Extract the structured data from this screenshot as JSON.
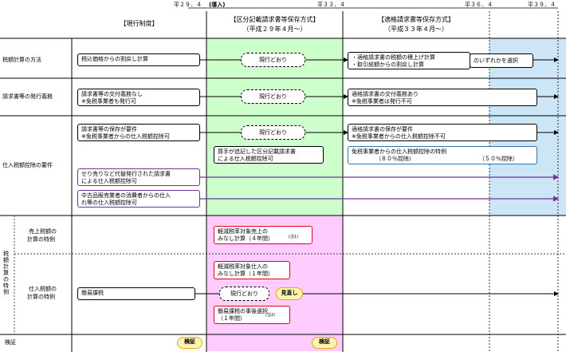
{
  "timeline": {
    "h29": "平２９．４",
    "h29_note": "(導入)",
    "h33": "平３３．４",
    "h36": "平３６．４",
    "h39": "平３９．４"
  },
  "columns": {
    "current": "【現行制度】",
    "kubun": "【区分記載請求書等保存方式】",
    "kubun_sub": "（平成２９年４月～）",
    "tekikaku": "【適格請求書等保存方式】",
    "tekikaku_sub": "（平成３３年４月～）"
  },
  "rows": {
    "calc": "税額計算の方法",
    "invoice": "請求書等の発行義務",
    "deduction": "仕入税額控除の要件",
    "sales_special_1": "売上税額の",
    "sales_special_2": "計算の特例",
    "purchase_special_1": "仕入税額の",
    "purchase_special_2": "計算の特例",
    "vertical_group": "税額計算の特例",
    "review": "検証"
  },
  "boxes": {
    "calc_current": "税込価格からの割戻し計算",
    "same": "現行どおり",
    "calc_new_1": "・適格請求書の税額の積上げ計算",
    "calc_new_2": "・取引総額からの割戻し計算",
    "calc_new_suffix": "のいずれかを選択",
    "invoice_current_1": "請求書等の交付義務なし",
    "invoice_current_2": "※免税事業者も発行可",
    "invoice_new_1": "適格請求書の交付義務あり",
    "invoice_new_2": "※免税事業者は発行不可",
    "deduction_current_1": "請求書等の保存が要件",
    "deduction_current_2": "※免税事業者からの仕入税額控除可",
    "deduction_new_1": "適格請求書の保存が要件",
    "deduction_new_2": "※免税事業者からの仕入税額控除不可",
    "buyer_note_1": "買手が追記した区分記載請求書",
    "buyer_note_2": "による仕入税額控除可",
    "exempt_special_1": "免税事業者からの仕入税額控除の特例",
    "exempt_special_2": "（８０％控除）",
    "exempt_special_3": "（５０％控除）",
    "agent_1": "せり売りなど代替発行された請求書",
    "agent_2": "による仕入税額控除可",
    "used_1": "中古品販売業者の消費者からの仕入",
    "used_2": "れ等の仕入税額控除可",
    "reduced_sales_1": "軽減税率対象売上の",
    "reduced_sales_2": "みなし計算（４年間）",
    "note1": "(注1)",
    "reduced_purchase_1": "軽減税率対象仕入の",
    "reduced_purchase_2": "みなし計算（１年間）",
    "simplified": "簡易課税",
    "review_label": "見直し",
    "simplified_after_1": "簡易課税の事後選択",
    "simplified_after_2": "（１年間）",
    "note2": "(注2)",
    "verify": "検証"
  },
  "colors": {
    "green": "#ccffcc",
    "pink": "#ffccff",
    "blue": "#cce6f8",
    "red": "#e0001e",
    "purple": "#7030a0",
    "border_blue": "#2e75b6",
    "yellow": "#fff2b3"
  }
}
